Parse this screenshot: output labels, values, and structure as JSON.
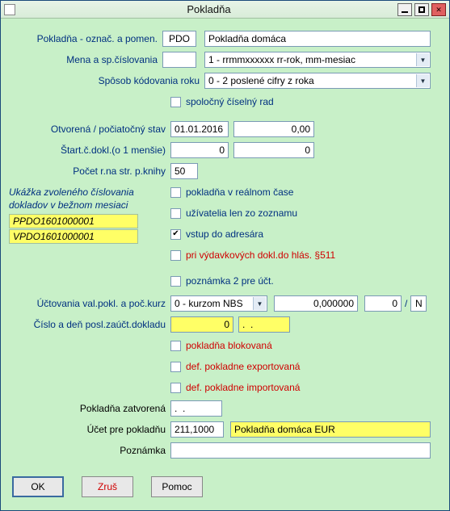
{
  "window": {
    "title": "Pokladňa"
  },
  "labels": {
    "oznac": "Pokladňa - označ. a pomen.",
    "mena": "Mena a sp.číslovania",
    "kodrok": "Spôsob kódovania roku",
    "spolrad": "spoločný číselný rad",
    "otvorena": "Otvorená / počiatočný stav",
    "startdokl": "Štart.č.dokl.(o 1 menšie)",
    "pocetr": "Počet r.na str. p.knihy",
    "realtime": "pokladňa v reálnom čase",
    "uziv": "užívatelia len zo zoznamu",
    "adresar": "vstup do adresára",
    "vydavky": "pri výdavkových dokl.do hlás. §511",
    "pozn2": "poznámka 2 pre účt.",
    "uctovania": "Účtovania val.pokl. a poč.kurz",
    "cisloposl": "Číslo a deň posl.zaúčt.dokladu",
    "blokovana": "pokladňa blokovaná",
    "exportovana": "def. pokladne exportovaná",
    "importovana": "def. pokladne importovaná",
    "zatvorena": "Pokladňa zatvorená",
    "ucet": "Účet pre pokladňu",
    "poznamka": "Poznámka",
    "sample_hdr1": "Ukážka zvoleného číslovania",
    "sample_hdr2": "dokladov v bežnom mesiaci"
  },
  "icons": {
    "minimize": "minimize-icon",
    "maximize": "maximize-icon",
    "close": "close-icon",
    "dropdown": "chevron-down-icon"
  },
  "values": {
    "pdo": "PDO",
    "pomen": "Pokladňa domáca",
    "mena": "",
    "mena_sel": "1 - rrmmxxxxxx   rr-rok, mm-mesiac",
    "kodrok_sel": "0 - 2 poslené cifry z roka",
    "chk_spolrad": false,
    "otvorena_date": "01.01.2016",
    "otvorena_val": "0,00",
    "start1": "0",
    "start2": "0",
    "pocetr": "50",
    "chk_realtime": false,
    "chk_uziv": false,
    "chk_adresar": true,
    "chk_vydavky": false,
    "chk_pozn2": false,
    "kurz_sel": "0 - kurzom NBS",
    "kurz_val": "0,000000",
    "kurz_small": "0",
    "kurz_flag": "N",
    "cisloposl_num": "0",
    "cisloposl_date": ".  .",
    "chk_blokovana": false,
    "chk_export": false,
    "chk_import": false,
    "zatvorena": ".  .",
    "ucet_num": "211,1000",
    "ucet_name": "Pokladňa domáca EUR",
    "poznamka": ""
  },
  "samples": {
    "s1": "PPDO1601000001",
    "s2": "VPDO1601000001"
  },
  "buttons": {
    "ok": "OK",
    "zrus": "Zruš",
    "pomoc": "Pomoc"
  }
}
